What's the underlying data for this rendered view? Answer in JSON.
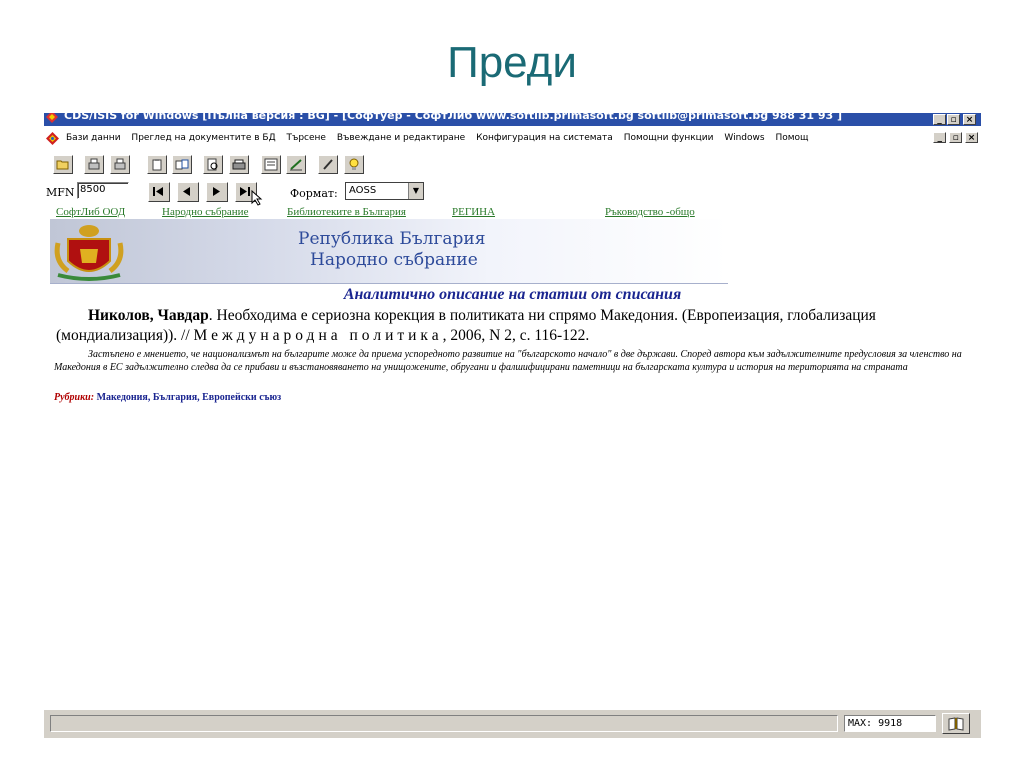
{
  "slide": {
    "title": "Преди"
  },
  "window": {
    "title": "CDS/ISIS for Windows [Пълна версия : BG] - [Софтуер - СофтЛиб www.softlib.primasoft.bg softlib@primasoft.bg 988 31 93 ]",
    "buttons": {
      "minimize": "_",
      "restore": "▫",
      "close": "×"
    }
  },
  "menu": {
    "items": [
      "Бази данни",
      "Преглед на документите в БД",
      "Търсене",
      "Въвеждане и редактиране",
      "Конфигурация на системата",
      "Помощни функции",
      "Windows",
      "Помощ"
    ],
    "mdi": {
      "minimize": "_",
      "restore": "▫",
      "close": "×"
    }
  },
  "nav": {
    "mfn_label": "MFN",
    "mfn_value": "8500",
    "format_label": "Формат:",
    "format_value": "AOSS"
  },
  "links": [
    "СофтЛиб ООД",
    "Народно събрание",
    "Библиотеките в България",
    "РЕГИНА",
    "Ръководство -общо"
  ],
  "banner": {
    "line1": "Република България",
    "line2": "Народно събрание"
  },
  "record": {
    "heading": "Аналитично описание на статии от списания",
    "author": "Николов, Чавдар",
    "title_part": ". Необходима е сериозна корекция в политиката ни спрямо Македония. (Европеизация, глобализация (мондиализация)). // ",
    "journal": "Международна политика",
    "source_tail": ", 2006, N 2, с. 116-122.",
    "abstract": "Застъпено е мнението, че национализмът на българите може да приема успоредното развитие на \"българското начало\" в две държави. Според автора към задължителните предусловия за членство на Македония в ЕС задължително следва да се прибави и възстановяването на унищожените, обругани и фалшифицирани паметници на българската култура и история на територията на страната",
    "rubrics_label": "Рубрики:",
    "rubrics_value": "Македония, България, Европейски съюз"
  },
  "status": {
    "max": "MAX: 9918"
  }
}
